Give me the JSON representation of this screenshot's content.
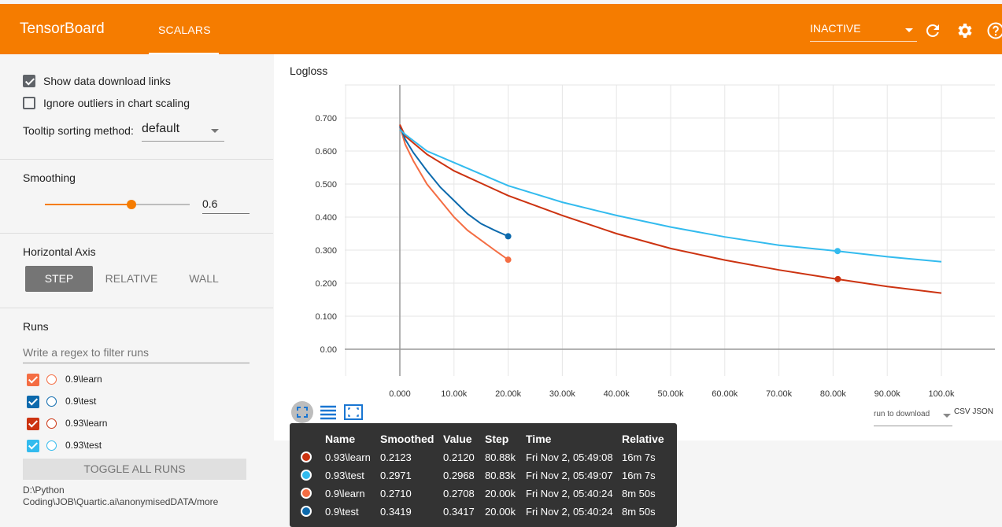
{
  "header": {
    "brand": "TensorBoard",
    "tab": "SCALARS",
    "status_select": "INACTIVE",
    "accent": "#f57c00"
  },
  "sidebar": {
    "show_download_links": "Show data download links",
    "ignore_outliers": "Ignore outliers in chart scaling",
    "tooltip_sort_label": "Tooltip sorting method:",
    "tooltip_sort_value": "default",
    "smoothing_label": "Smoothing",
    "smoothing_value": "0.6",
    "horizontal_axis_label": "Horizontal Axis",
    "axis_options": [
      "STEP",
      "RELATIVE",
      "WALL"
    ],
    "runs_label": "Runs",
    "filter_placeholder": "Write a regex to filter runs",
    "runs": [
      {
        "name": "0.9\\learn",
        "color": "#f46d43"
      },
      {
        "name": "0.9\\test",
        "color": "#0d6aad"
      },
      {
        "name": "0.93\\learn",
        "color": "#cc3311"
      },
      {
        "name": "0.93\\test",
        "color": "#33bbee"
      }
    ],
    "toggle_all": "TOGGLE ALL RUNS",
    "path": "D:\\Python Coding\\JOB\\Quartic.ai\\anonymisedDATA/more"
  },
  "chart_controls": {
    "download_select": "run to download",
    "download_links": "CSV JSON"
  },
  "chart_data": {
    "type": "line",
    "title": "Logloss",
    "xlabel": "",
    "ylabel": "",
    "xlim": [
      0,
      100000
    ],
    "ylim": [
      -0.003,
      0.77
    ],
    "x_ticks": [
      "0.000",
      "10.00k",
      "20.00k",
      "30.00k",
      "40.00k",
      "50.00k",
      "60.00k",
      "70.00k",
      "80.00k",
      "90.00k",
      "100.0k"
    ],
    "y_ticks": [
      "0.00",
      "0.100",
      "0.200",
      "0.300",
      "0.400",
      "0.500",
      "0.600",
      "0.700"
    ],
    "grid": true,
    "series": [
      {
        "name": "0.9\\learn",
        "color": "#f46d43",
        "x": [
          0,
          1000,
          2500,
          5000,
          7500,
          10000,
          12500,
          15000,
          17500,
          20000
        ],
        "y": [
          0.675,
          0.62,
          0.57,
          0.5,
          0.45,
          0.4,
          0.36,
          0.33,
          0.3,
          0.271
        ]
      },
      {
        "name": "0.9\\test",
        "color": "#0d6aad",
        "x": [
          0,
          1000,
          2500,
          5000,
          7500,
          10000,
          12500,
          15000,
          17500,
          20000
        ],
        "y": [
          0.675,
          0.635,
          0.595,
          0.54,
          0.49,
          0.45,
          0.41,
          0.38,
          0.36,
          0.342
        ]
      },
      {
        "name": "0.93\\learn",
        "color": "#cc3311",
        "x": [
          0,
          1000,
          5000,
          10000,
          20000,
          30000,
          40000,
          50000,
          60000,
          70000,
          80880,
          90000,
          100000
        ],
        "y": [
          0.68,
          0.645,
          0.59,
          0.54,
          0.465,
          0.405,
          0.35,
          0.305,
          0.27,
          0.24,
          0.212,
          0.19,
          0.17
        ]
      },
      {
        "name": "0.93\\test",
        "color": "#33bbee",
        "x": [
          0,
          1000,
          5000,
          10000,
          20000,
          30000,
          40000,
          50000,
          60000,
          70000,
          80830,
          90000,
          100000
        ],
        "y": [
          0.665,
          0.65,
          0.6,
          0.565,
          0.495,
          0.445,
          0.405,
          0.37,
          0.34,
          0.315,
          0.297,
          0.28,
          0.265
        ]
      }
    ],
    "highlight_points": [
      {
        "series": "0.93\\learn",
        "x": 80880,
        "y": 0.2123
      },
      {
        "series": "0.93\\test",
        "x": 80830,
        "y": 0.2971
      },
      {
        "series": "0.9\\learn",
        "x": 20000,
        "y": 0.271
      },
      {
        "series": "0.9\\test",
        "x": 20000,
        "y": 0.3419
      }
    ]
  },
  "tooltip": {
    "headers": [
      "Name",
      "Smoothed",
      "Value",
      "Step",
      "Time",
      "Relative"
    ],
    "rows": [
      {
        "color": "#cc3311",
        "name": "0.93\\learn",
        "smoothed": "0.2123",
        "value": "0.2120",
        "step": "80.88k",
        "time": "Fri Nov 2, 05:49:08",
        "relative": "16m 7s"
      },
      {
        "color": "#33bbee",
        "name": "0.93\\test",
        "smoothed": "0.2971",
        "value": "0.2968",
        "step": "80.83k",
        "time": "Fri Nov 2, 05:49:07",
        "relative": "16m 7s"
      },
      {
        "color": "#f46d43",
        "name": "0.9\\learn",
        "smoothed": "0.2710",
        "value": "0.2708",
        "step": "20.00k",
        "time": "Fri Nov 2, 05:40:24",
        "relative": "8m 50s"
      },
      {
        "color": "#0d6aad",
        "name": "0.9\\test",
        "smoothed": "0.3419",
        "value": "0.3417",
        "step": "20.00k",
        "time": "Fri Nov 2, 05:40:24",
        "relative": "8m 50s"
      }
    ]
  }
}
